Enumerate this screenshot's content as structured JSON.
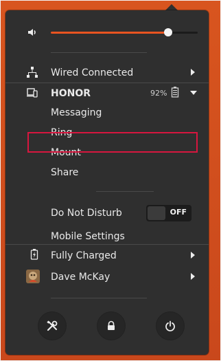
{
  "volume": {
    "level": 0.8,
    "accent": "#e95420"
  },
  "menu": {
    "wired": "Wired Connected",
    "device": "HONOR",
    "device_battery": "92%",
    "sub": [
      "Messaging",
      "Ring",
      "Mount",
      "Share"
    ],
    "dnd": "Do Not Disturb",
    "dnd_state": "OFF",
    "mobile_settings": "Mobile Settings",
    "battery": "Fully Charged",
    "user": "Dave McKay"
  },
  "icons": {
    "volume": "speaker-icon",
    "wired": "network-wired-icon",
    "device": "phone-device-icon",
    "battery": "battery-charged-icon",
    "user": "avatar",
    "settings": "settings-tools-icon",
    "lock": "lock-icon",
    "power": "power-icon"
  },
  "colors": {
    "highlight": "#d8163f",
    "panel": "#2f2f2f",
    "wallpaper": "#d8551f"
  }
}
